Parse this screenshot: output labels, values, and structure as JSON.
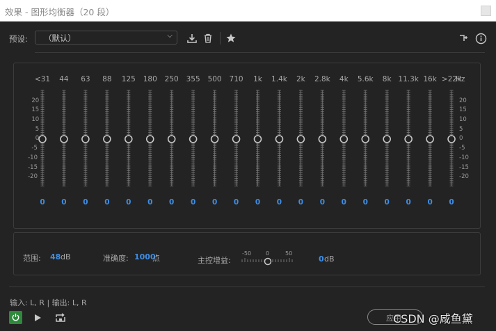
{
  "window": {
    "title": "效果 - 图形均衡器（20 段）"
  },
  "preset": {
    "label": "预设:",
    "value": "（默认）"
  },
  "toolbar": {
    "icons": [
      "download-icon",
      "trash-icon",
      "star-icon",
      "routing-icon",
      "info-icon"
    ]
  },
  "eq": {
    "bands": [
      "<31",
      "44",
      "63",
      "88",
      "125",
      "180",
      "250",
      "355",
      "500",
      "710",
      "1k",
      "1.4k",
      "2k",
      "2.8k",
      "4k",
      "5.6k",
      "8k",
      "11.3k",
      "16k",
      ">22k"
    ],
    "unit": "Hz",
    "values": [
      "0",
      "0",
      "0",
      "0",
      "0",
      "0",
      "0",
      "0",
      "0",
      "0",
      "0",
      "0",
      "0",
      "0",
      "0",
      "0",
      "0",
      "0",
      "0",
      "0"
    ],
    "scale": [
      "20",
      "15",
      "10",
      "5",
      "0",
      "-5",
      "-10",
      "-15",
      "-20"
    ]
  },
  "controls": {
    "range_label": "范围:",
    "range_value": "48",
    "range_unit": "dB",
    "accuracy_label": "准确度:",
    "accuracy_value": "1000",
    "accuracy_unit": "点",
    "gain_label": "主控增益:",
    "gain_scale": [
      "-50",
      "0",
      "50"
    ],
    "gain_value": "0",
    "gain_unit": "dB",
    "gain_level": 0
  },
  "footer": {
    "io_text": "输入: L, R | 输出: L, R",
    "apply_label": "应用",
    "watermark": "CSDN @咸鱼黛"
  },
  "colors": {
    "accent": "#3d8ee6",
    "power": "#2c8a3a",
    "background": "#232323"
  }
}
